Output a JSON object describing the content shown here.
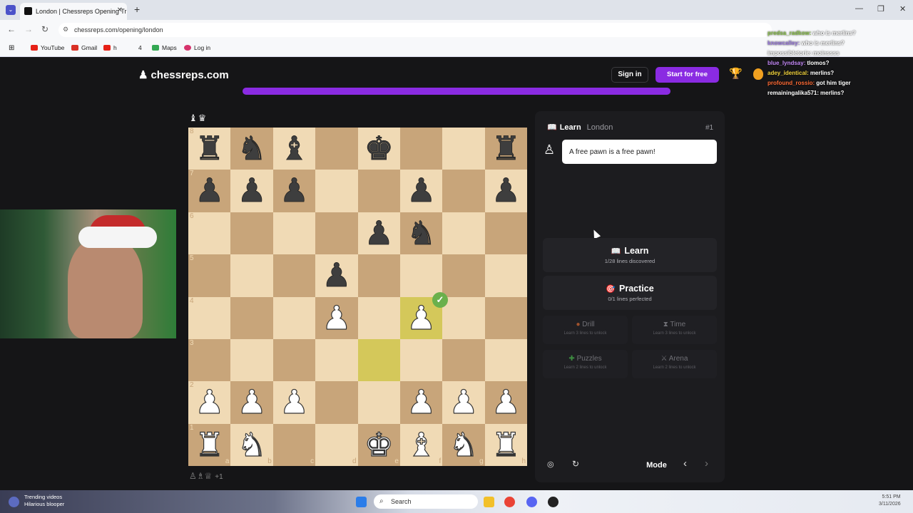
{
  "browser": {
    "tab_title": "London | Chessreps Opening Tr",
    "url": "chessreps.com/opening/london",
    "bookmarks": [
      {
        "label": "YouTube",
        "icon": "youtube-icon",
        "color": "#e62117"
      },
      {
        "label": "Gmail",
        "icon": "gmail-icon",
        "color": "#d93025"
      },
      {
        "label": "h",
        "icon": "h-icon",
        "color": "#e62117"
      },
      {
        "label": "4",
        "icon": "four-icon",
        "color": "#888888"
      },
      {
        "label": "Maps",
        "icon": "maps-icon",
        "color": "#34a853"
      },
      {
        "label": "Log in",
        "icon": "login-icon",
        "color": "#d6336c"
      }
    ]
  },
  "header": {
    "logo": "chessreps.com",
    "sign_in": "Sign in",
    "start_free": "Start for free",
    "progress_fraction": 1.0,
    "accent_color": "#8a2be2"
  },
  "board": {
    "captured_top": "♝♛",
    "captured_bottom": "♙♗♕",
    "captured_bottom_extra": "+1",
    "files": [
      "a",
      "b",
      "c",
      "d",
      "e",
      "f",
      "g",
      "h"
    ],
    "ranks": [
      "8",
      "7",
      "6",
      "5",
      "4",
      "3",
      "2",
      "1"
    ],
    "position": [
      [
        "r",
        "n",
        "b",
        "",
        "k",
        "",
        "",
        "r"
      ],
      [
        "p",
        "p",
        "p",
        "",
        "",
        "p",
        "",
        "p"
      ],
      [
        "",
        "",
        "",
        "",
        "p",
        "n",
        "",
        ""
      ],
      [
        "",
        "",
        "",
        "p",
        "",
        "",
        "",
        ""
      ],
      [
        "",
        "",
        "",
        "P",
        "",
        "P",
        "",
        ""
      ],
      [
        "",
        "",
        "",
        "",
        "",
        "",
        "",
        ""
      ],
      [
        "P",
        "P",
        "P",
        "",
        "",
        "P",
        "P",
        "P"
      ],
      [
        "R",
        "N",
        "",
        "",
        "K",
        "B",
        "N",
        "R"
      ]
    ],
    "highlight_squares": [
      "e3",
      "f4"
    ],
    "correct_square": "f4"
  },
  "panel": {
    "header_title": "Learn",
    "header_sub": "London",
    "header_num": "#1",
    "coach_message": "A free pawn is a free pawn!",
    "learn": {
      "title": "Learn",
      "sub": "1/28 lines discovered"
    },
    "practice": {
      "title": "Practice",
      "sub": "0/1 lines perfected"
    },
    "drill": {
      "title": "Drill",
      "sub": "Learn 3 lines to unlock"
    },
    "time": {
      "title": "Time",
      "sub": "Learn 3 lines to unlock"
    },
    "puzzles": {
      "title": "Puzzles",
      "sub": "Learn 2 lines to unlock"
    },
    "arena": {
      "title": "Arena",
      "sub": "Learn 2 lines to unlock"
    },
    "mode_label": "Mode"
  },
  "chat": [
    {
      "user": "predsa_radkow:",
      "msg": "who is merlins?",
      "color": "#8bc34a"
    },
    {
      "user": "knowcalley:",
      "msg": "who is merlins?",
      "color": "#9c7be0"
    },
    {
      "user": "impossibletorie:",
      "msg": "moinssss",
      "color": "#ffffff"
    },
    {
      "user": "blue_lyndsay:",
      "msg": "tlomos?",
      "color": "#c58af9"
    },
    {
      "user": "adey_identical:",
      "msg": "merlins?",
      "color": "#f0d23c"
    },
    {
      "user": "profound_rossio:",
      "msg": "got him tiger",
      "color": "#ff6b35"
    },
    {
      "user": "remainingalika571:",
      "msg": "merlins?",
      "color": "#ffffff"
    }
  ],
  "taskbar": {
    "news_line1": "Trending videos",
    "news_line2": "Hilarious blooper",
    "search_placeholder": "Search",
    "time": "5:51 PM",
    "date": "3/11/2026"
  }
}
